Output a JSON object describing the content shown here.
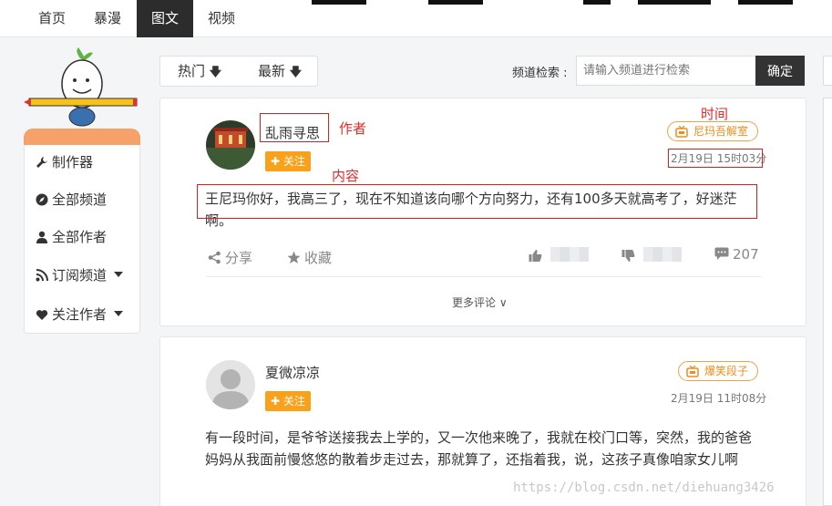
{
  "topnav": {
    "tabs": [
      {
        "label": "首页",
        "active": false
      },
      {
        "label": "暴漫",
        "active": false
      },
      {
        "label": "图文",
        "active": true
      },
      {
        "label": "视频",
        "active": false
      }
    ]
  },
  "sidebar": {
    "items": [
      {
        "label": "制作器",
        "icon": "wrench-icon"
      },
      {
        "label": "全部频道",
        "icon": "compass-icon"
      },
      {
        "label": "全部作者",
        "icon": "user-icon"
      },
      {
        "label": "订阅频道",
        "icon": "rss-icon"
      },
      {
        "label": "关注作者",
        "icon": "heart-icon"
      }
    ]
  },
  "sort": {
    "hot": "热门",
    "latest": "最新"
  },
  "search": {
    "label": "频道检索 :",
    "placeholder": "请输入频道进行检索",
    "button": "确定"
  },
  "posts": [
    {
      "author": "乱雨寻思",
      "follow": "关注",
      "channel": "尼玛吾解室",
      "time": "2月19日 15时03分",
      "content": "王尼玛你好，我高三了，现在不知道该向哪个方向努力，还有100多天就高考了，好迷茫啊。",
      "share": "分享",
      "collect": "收藏",
      "comments": "207",
      "more": "更多评论"
    },
    {
      "author": "夏微凉凉",
      "follow": "关注",
      "channel": "爆笑段子",
      "time": "2月19日 11时08分",
      "content": "有一段时间，是爷爷送接我去上学的，又一次他来晚了，我就在校门口等，突然，我的爸爸妈妈从我面前慢悠悠的散着步走过去，那就算了，还指着我，说，这孩子真像咱家女儿啊"
    }
  ],
  "annotations": {
    "author": "作者",
    "time": "时间",
    "content": "内容"
  },
  "watermark": "https://blog.csdn.net/diehuang3426",
  "colors": {
    "accent": "#f9a11b",
    "annotation": "#d91f1f",
    "nav_active": "#2c2c2c"
  }
}
